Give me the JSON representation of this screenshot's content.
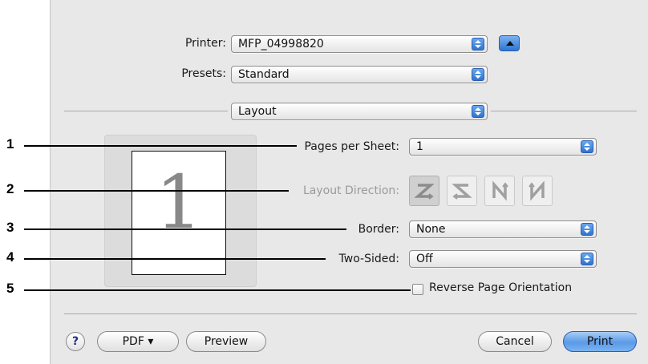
{
  "printer": {
    "label": "Printer:",
    "value": "MFP_04998820"
  },
  "presets": {
    "label": "Presets:",
    "value": "Standard"
  },
  "section": {
    "value": "Layout"
  },
  "preview": {
    "page_number": "1"
  },
  "pages_per_sheet": {
    "label": "Pages per Sheet:",
    "value": "1"
  },
  "layout_direction": {
    "label": "Layout Direction:",
    "options": [
      "z-order",
      "reverse-z-order",
      "n-order",
      "reverse-n-order"
    ],
    "selected": "z-order"
  },
  "border": {
    "label": "Border:",
    "value": "None"
  },
  "two_sided": {
    "label": "Two-Sided:",
    "value": "Off"
  },
  "reverse_orientation": {
    "label": "Reverse Page Orientation",
    "checked": false
  },
  "callouts": [
    "1",
    "2",
    "3",
    "4",
    "5"
  ],
  "buttons": {
    "help": "?",
    "pdf": "PDF ▾",
    "preview": "Preview",
    "cancel": "Cancel",
    "print": "Print"
  },
  "colors": {
    "accent": "#3a7bd5",
    "dialog_bg": "#e8e8e8"
  }
}
